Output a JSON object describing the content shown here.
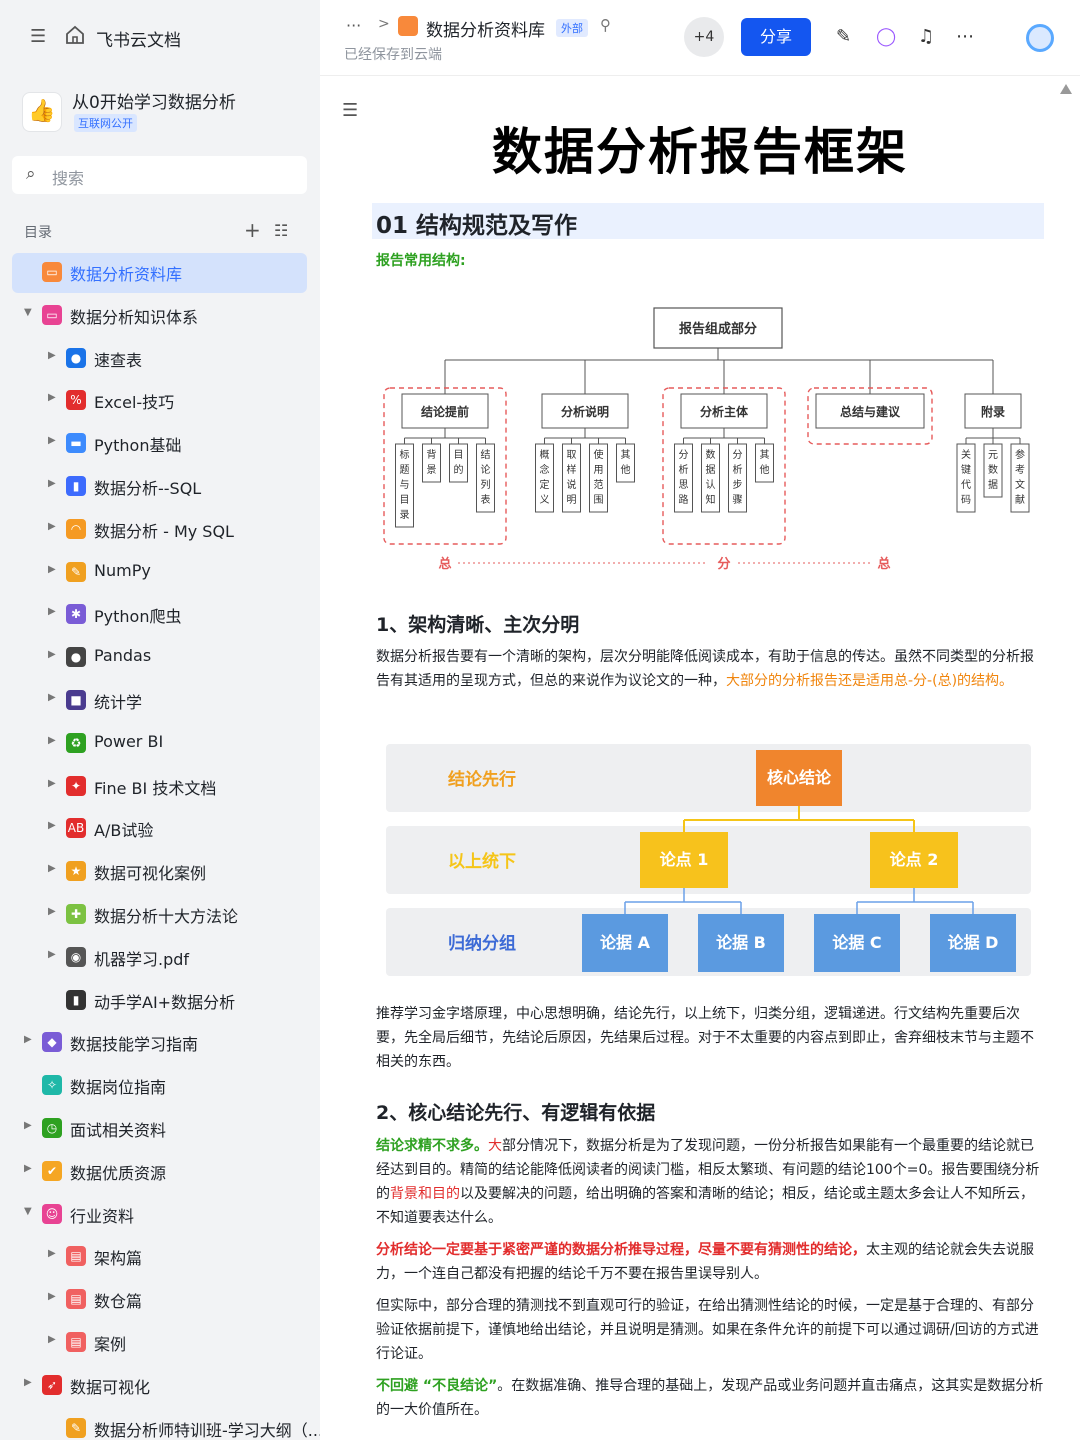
{
  "sidebar": {
    "app_name": "飞书云文档",
    "knowledge_base": {
      "name": "从0开始学习数据分析",
      "badge": "互联网公开"
    },
    "search_placeholder": "搜索",
    "toc_label": "目录",
    "items": [
      {
        "label": "数据分析资料库",
        "icon": "folder-icon",
        "color": "#f8893b"
      },
      {
        "label": "数据分析知识体系",
        "icon": "folder-icon",
        "color": "#e84393"
      },
      {
        "label": "速查表",
        "icon": "magnifier-icon",
        "color": "#1a73e8"
      },
      {
        "label": "Excel-技巧",
        "icon": "hundred-icon",
        "color": "#e22d2d"
      },
      {
        "label": "Python基础",
        "icon": "laptop-icon",
        "color": "#3d8bfd"
      },
      {
        "label": "数据分析--SQL",
        "icon": "bar-chart-icon",
        "color": "#3d6bfd"
      },
      {
        "label": "数据分析 - My SQL",
        "icon": "rainbow-icon",
        "color": "#f59a23"
      },
      {
        "label": "NumPy",
        "icon": "memo-icon",
        "color": "#f0a020"
      },
      {
        "label": "Python爬虫",
        "icon": "spider-icon",
        "color": "#7a5cd6"
      },
      {
        "label": "Pandas",
        "icon": "panda-icon",
        "color": "#444444"
      },
      {
        "label": "统计学",
        "icon": "floppy-icon",
        "color": "#4a3b8f"
      },
      {
        "label": "Power BI",
        "icon": "recycle-icon",
        "color": "#2ea121"
      },
      {
        "label": "Fine BI 技术文档",
        "icon": "pushpin-icon",
        "color": "#e22d2d"
      },
      {
        "label": "A/B试验",
        "icon": "ab-icon",
        "color": "#e22d2d"
      },
      {
        "label": "数据可视化案例",
        "icon": "medal-icon",
        "color": "#f0a020"
      },
      {
        "label": "数据分析十大方法论",
        "icon": "puzzle-icon",
        "color": "#7cc242"
      },
      {
        "label": "机器学习.pdf",
        "icon": "robot-icon",
        "color": "#555555"
      },
      {
        "label": "动手学AI+数据分析",
        "icon": "traffic-light-icon",
        "color": "#333333"
      },
      {
        "label": "数据技能学习指南",
        "icon": "cube-icon",
        "color": "#7a5cd6"
      },
      {
        "label": "数据岗位指南",
        "icon": "sparkle-icon",
        "color": "#1fb8a8"
      },
      {
        "label": "面试相关资料",
        "icon": "clock-icon",
        "color": "#2ea121"
      },
      {
        "label": "数据优质资源",
        "icon": "thumbs-up-icon",
        "color": "#f5a623"
      },
      {
        "label": "行业资料",
        "icon": "ghost-icon",
        "color": "#e84393"
      },
      {
        "label": "架构篇",
        "icon": "doc-icon",
        "color": "#f06060"
      },
      {
        "label": "数仓篇",
        "icon": "doc-icon",
        "color": "#f06060"
      },
      {
        "label": "案例",
        "icon": "doc-icon",
        "color": "#f06060"
      },
      {
        "label": "数据可视化",
        "icon": "rocket-icon",
        "color": "#e22d2d"
      },
      {
        "label": "数据分析师特训班-学习大纲（...",
        "icon": "memo-icon",
        "color": "#f0a020"
      }
    ]
  },
  "topbar": {
    "breadcrumb_title": "数据分析资料库",
    "external_badge": "外部",
    "saved_status": "已经保存到云端",
    "collaborators": "+4",
    "share_label": "分享"
  },
  "doc": {
    "title": "数据分析报告框架",
    "section_heading": "01 结构规范及写作",
    "structure_label": "报告常用结构:",
    "diagram1": {
      "root": "报告组成部分",
      "groups": [
        {
          "label": "结论提前",
          "children": [
            "标题与目录",
            "背景",
            "目的",
            "结论列表"
          ],
          "dashed": true
        },
        {
          "label": "分析说明",
          "children": [
            "概念定义",
            "取样说明",
            "使用范围",
            "其他"
          ],
          "dashed": false
        },
        {
          "label": "分析主体",
          "children": [
            "分析思路",
            "数据认知",
            "分析步骤",
            "其他"
          ],
          "dashed": true
        },
        {
          "label": "总结与建议",
          "children": [],
          "dashed": true
        },
        {
          "label": "附录",
          "children": [
            "关键代码",
            "元数据",
            "参考文献"
          ],
          "dashed": false
        }
      ],
      "flow": [
        "总",
        "分",
        "总"
      ]
    },
    "h2_1": "1、架构清晰、主次分明",
    "p1_normal": "数据分析报告要有一个清晰的架构，层次分明能降低阅读成本，有助于信息的传达。虽然不同类型的分析报告有其适用的呈现方式，但总的来说作为议论文的一种，",
    "p1_highlight": "大部分的分析报告还是适用总-分-(总)的结构。",
    "diagram2": {
      "rows": [
        "结论先行",
        "以上统下",
        "归纳分组"
      ],
      "core": "核心结论",
      "points": [
        "论点 1",
        "论点 2"
      ],
      "evidence": [
        "论据 A",
        "论据 B",
        "论据 C",
        "论据 D"
      ]
    },
    "p2": "推荐学习金字塔原理，中心思想明确，结论先行，以上统下，归类分组，逻辑递进。行文结构先重要后次要，先全局后细节，先结论后原因，先结果后过程。对于不太重要的内容点到即止，舍弃细枝末节与主题不相关的东西。",
    "h2_2": "2、核心结论先行、有逻辑有依据",
    "p3_lead": "结论求精不求多。",
    "p3_red": "大",
    "p3_a": "部分情况下，数据分析是为了发现问题，一份分析报告如果能有一个最重要的结论就已经达到目的。精简的结论能降低阅读者的阅读门槛，相反太繁琐、有问题的结论100个=0。报告要围绕分析的",
    "p3_red2": "背景和目的",
    "p3_b": "以及要解决的问题，给出明确的答案和清晰的结论；相反，结论或主题太多会让人不知所云，不知道要表达什么。",
    "p4_red": "分析结论一定要基于紧密严谨的数据分析推导过程，尽量不要有猜测性的结论，",
    "p4_rest": "太主观的结论就会失去说服力，一个连自己都没有把握的结论千万不要在报告里误导别人。",
    "p5": "但实际中，部分合理的猜测找不到直观可行的验证，在给出猜测性结论的时候，一定是基于合理的、有部分验证依据前提下，谨慎地给出结论，并且说明是猜测。如果在条件允许的前提下可以通过调研/回访的方式进行论证。",
    "p6_lead": "不回避 “不良结论”",
    "p6_rest": "。在数据准确、推导合理的基础上，发现产品或业务问题并直击痛点，这其实是数据分析的一大价值所在。"
  }
}
